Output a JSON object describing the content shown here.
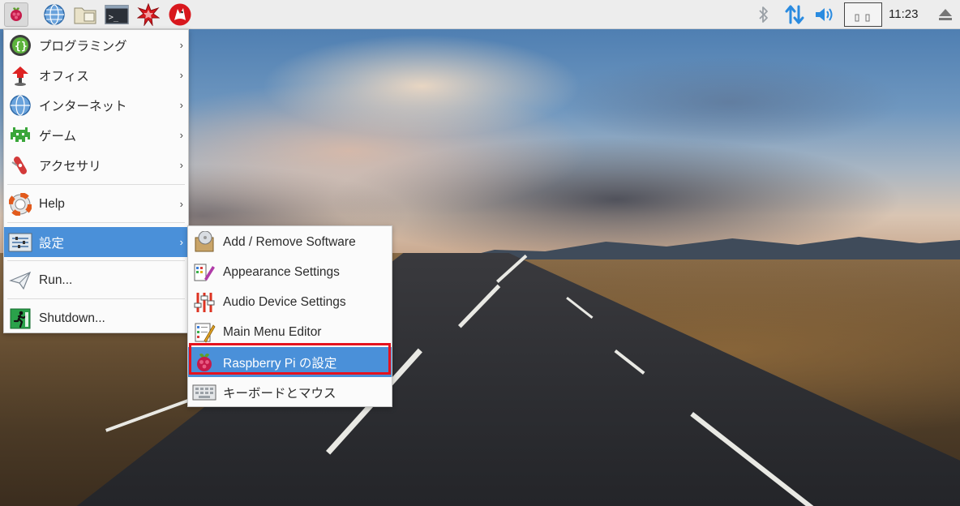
{
  "panel": {
    "clock": "11:23",
    "launchers": [
      "raspberry-menu-icon",
      "web-browser-icon",
      "file-manager-icon",
      "terminal-icon",
      "mathematica-icon",
      "wolfram-icon"
    ],
    "tray": [
      "bluetooth-icon",
      "network-icon",
      "volume-icon",
      "cpu-monitor",
      "eject-icon"
    ]
  },
  "main_menu": {
    "items": [
      {
        "label": "プログラミング",
        "icon": "programming-icon",
        "has_submenu": true
      },
      {
        "label": "オフィス",
        "icon": "office-icon",
        "has_submenu": true
      },
      {
        "label": "インターネット",
        "icon": "internet-icon",
        "has_submenu": true
      },
      {
        "label": "ゲーム",
        "icon": "games-icon",
        "has_submenu": true
      },
      {
        "label": "アクセサリ",
        "icon": "accessories-icon",
        "has_submenu": true
      },
      {
        "label": "Help",
        "icon": "help-icon",
        "has_submenu": true
      },
      {
        "label": "設定",
        "icon": "preferences-icon",
        "has_submenu": true,
        "active": true
      },
      {
        "label": "Run...",
        "icon": "run-icon",
        "has_submenu": false
      },
      {
        "label": "Shutdown...",
        "icon": "shutdown-icon",
        "has_submenu": false
      }
    ]
  },
  "sub_menu": {
    "items": [
      {
        "label": "Add / Remove Software",
        "icon": "add-remove-software-icon"
      },
      {
        "label": "Appearance Settings",
        "icon": "appearance-settings-icon"
      },
      {
        "label": "Audio Device Settings",
        "icon": "audio-device-settings-icon"
      },
      {
        "label": "Main Menu Editor",
        "icon": "main-menu-editor-icon"
      },
      {
        "label": "Raspberry Pi の設定",
        "icon": "raspberry-pi-config-icon",
        "highlighted": true
      },
      {
        "label": "キーボードとマウス",
        "icon": "keyboard-mouse-icon"
      }
    ]
  },
  "colors": {
    "menu_selection": "#4a90d9",
    "highlight_box": "#e5121e",
    "panel_bg": "#ededed"
  }
}
